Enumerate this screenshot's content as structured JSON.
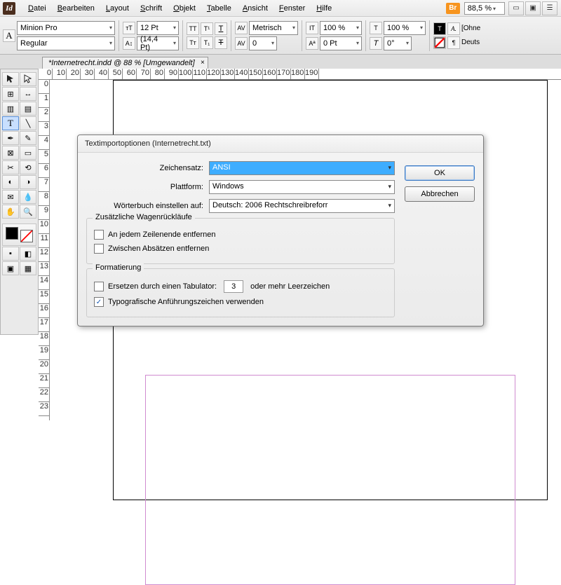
{
  "menubar": [
    "Datei",
    "Bearbeiten",
    "Layout",
    "Schrift",
    "Objekt",
    "Tabelle",
    "Ansicht",
    "Fenster",
    "Hilfe"
  ],
  "header": {
    "br": "Br",
    "zoom": "88,5 %"
  },
  "toolbar": {
    "font": "Minion Pro",
    "style": "Regular",
    "size": "12 Pt",
    "leading": "(14,4 Pt)",
    "kerning": "Metrisch",
    "tracking": "0",
    "hscale": "100 %",
    "vscale": "100 %",
    "baseline": "0 Pt",
    "lang": "Deuts",
    "lang_hint": "[Ohne"
  },
  "tab": {
    "title": "*Internetrecht.indd @ 88 % [Umgewandelt]"
  },
  "ruler_h": [
    "0",
    "10",
    "20",
    "30",
    "40",
    "50",
    "60",
    "70",
    "80",
    "90",
    "100",
    "110",
    "120",
    "130",
    "140",
    "150",
    "160",
    "170",
    "180",
    "190"
  ],
  "ruler_v": [
    "0",
    "1",
    "2",
    "3",
    "4",
    "5",
    "6",
    "7",
    "8",
    "9",
    "10",
    "11",
    "12",
    "13",
    "14",
    "15",
    "16",
    "17",
    "18",
    "19",
    "20",
    "21",
    "22",
    "23"
  ],
  "dialog": {
    "title": "Textimportoptionen (Internetrecht.txt)",
    "ok": "OK",
    "cancel": "Abbrechen",
    "labels": {
      "charset": "Zeichensatz:",
      "platform": "Plattform:",
      "dict": "Wörterbuch einstellen auf:",
      "returns": "Zusätzliche Wagenrückläufe",
      "eol": "An jedem Zeilenende entfernen",
      "para": "Zwischen Absätzen entfernen",
      "formatting": "Formatierung",
      "tabs_pre": "Ersetzen durch einen Tabulator:",
      "tabs_post": "oder mehr Leerzeichen",
      "quotes": "Typografische Anführungszeichen verwenden"
    },
    "values": {
      "charset": "ANSI",
      "platform": "Windows",
      "dict": "Deutsch: 2006 Rechtschreibreforr",
      "tabs_count": "3"
    }
  },
  "a_label": "A"
}
